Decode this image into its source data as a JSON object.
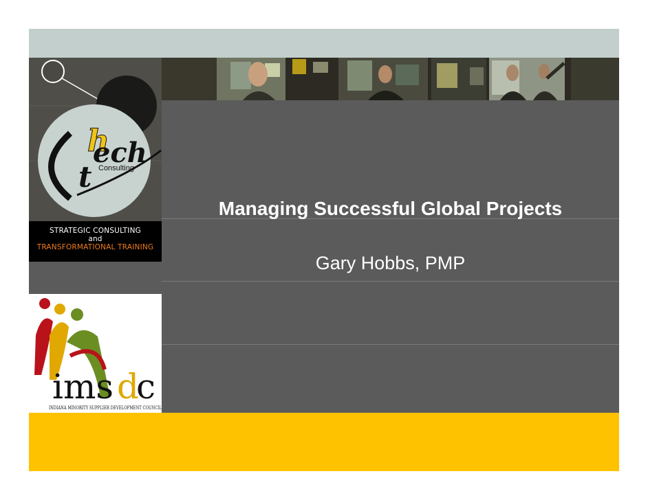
{
  "slide": {
    "title": "Managing Successful Global Projects",
    "subtitle": "Gary Hobbs, PMP"
  },
  "htech_logo": {
    "letters_h": "h",
    "letters_tech": "tech",
    "consulting": "Consulting"
  },
  "tagline": {
    "line1": "STRATEGIC CONSULTING",
    "line2": "and",
    "line3": "TRANSFORMATIONAL TRAINING"
  },
  "imsdc_logo": {
    "wordmark": "imsdc",
    "full_name": "INDIANA MINORITY SUPPLIER DEVELOPMENT COUNCIL"
  },
  "colors": {
    "top_band": "#c2cfcc",
    "main_panel": "#5b5b5b",
    "yellow_band": "#fec200",
    "tagline_orange": "#f07c20",
    "imsdc_red": "#b9121b",
    "imsdc_green": "#6b8e23",
    "imsdc_gold": "#e0a800"
  }
}
